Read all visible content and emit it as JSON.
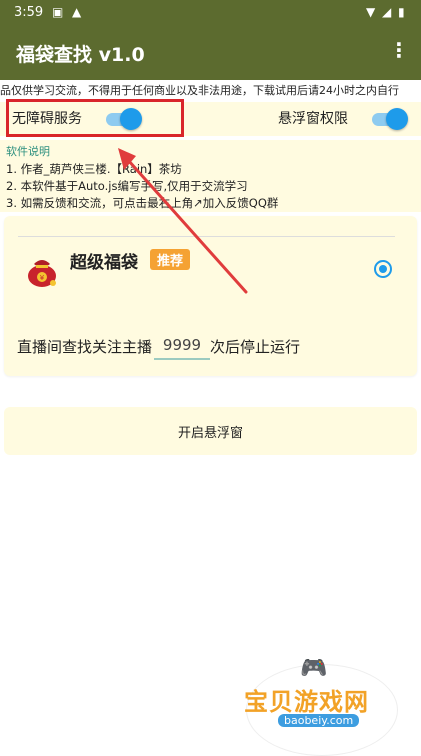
{
  "status_bar": {
    "time": "3:59",
    "left_icons": [
      "a-icon",
      "warning-icon"
    ],
    "right_icons": [
      "wifi-icon",
      "signal-icon",
      "battery-icon"
    ]
  },
  "app_bar": {
    "title": "福袋查找 v1.0",
    "menu_icon": "more-vert-icon"
  },
  "marquee_text": "品仅供学习交流，不得用于任何商业以及非法用途，下载试用后请24小时之内自行",
  "toggles": [
    {
      "label": "无障碍服务",
      "on": true
    },
    {
      "label": "悬浮窗权限",
      "on": true
    }
  ],
  "info": {
    "heading": "软件说明",
    "lines": [
      "1. 作者_葫芦侠三楼.【Rain】茶坊",
      "2. 本软件基于Auto.js编写手写,仅用于交流学习",
      "3. 如需反馈和交流，可点击最右上角↗加入反馈QQ群"
    ]
  },
  "card": {
    "name": "超级福袋",
    "badge": "推荐",
    "selected": true,
    "search_prefix": "直播间查找关注主播",
    "count_value": "9999",
    "search_suffix": "次后停止运行"
  },
  "open_button": "开启悬浮窗",
  "watermark": {
    "cn": "宝贝游戏网",
    "en": "baobeiy.com"
  },
  "colors": {
    "app_bar": "#5c6b2f",
    "panel": "#fffbe0",
    "accent": "#1e9bea",
    "badge": "#f5a233",
    "highlight": "#d9252b"
  }
}
